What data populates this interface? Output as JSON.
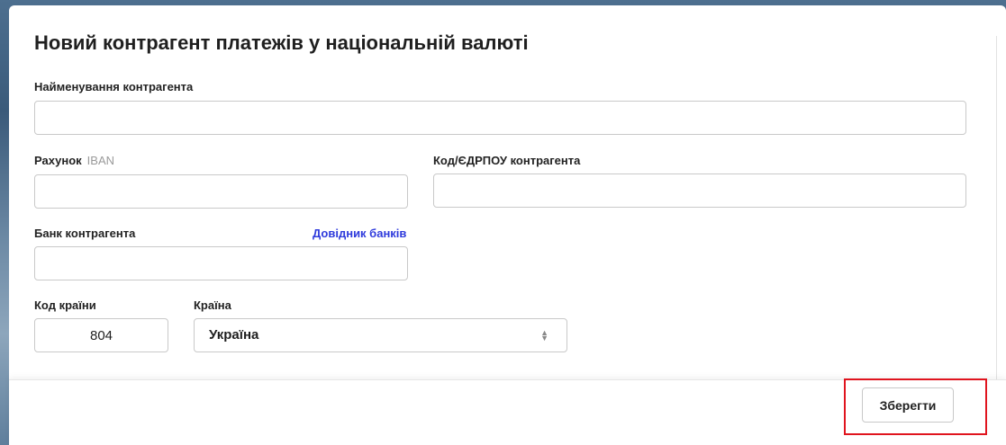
{
  "form": {
    "title": "Новий контрагент платежів у національній валюті",
    "name_label": "Найменування контрагента",
    "name_value": "",
    "account_label": "Рахунок",
    "account_hint": "IBAN",
    "account_value": "",
    "code_label": "Код/ЄДРПОУ контрагента",
    "code_value": "",
    "bank_label": "Банк контрагента",
    "bank_link": "Довідник банків",
    "bank_value": "",
    "country_code_label": "Код країни",
    "country_code_value": "804",
    "country_label": "Країна",
    "country_value": "Україна"
  },
  "footer": {
    "save_label": "Зберегти"
  },
  "colors": {
    "link": "#2f3bdc",
    "highlight": "#e0141e"
  }
}
